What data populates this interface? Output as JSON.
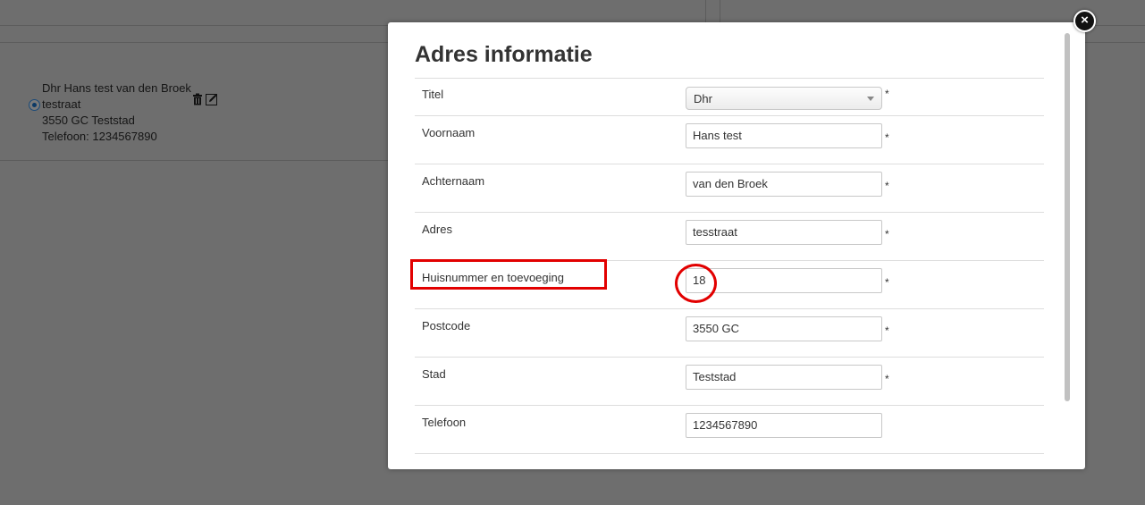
{
  "background": {
    "address": {
      "name_line": "Dhr Hans test van den Broek",
      "street_line": "testraat",
      "city_line": "3550 GC Teststad",
      "phone_line": "Telefoon: 1234567890"
    }
  },
  "modal": {
    "title": "Adres informatie",
    "required_mark": "*",
    "fields": [
      {
        "label": "Titel",
        "value": "Dhr",
        "type": "select",
        "required": true
      },
      {
        "label": "Voornaam",
        "value": "Hans test",
        "type": "text",
        "required": true
      },
      {
        "label": "Achternaam",
        "value": "van den Broek",
        "type": "text",
        "required": true
      },
      {
        "label": "Adres",
        "value": "tesstraat",
        "type": "text",
        "required": true
      },
      {
        "label": "Huisnummer en toevoeging",
        "value": "18",
        "type": "text",
        "required": true
      },
      {
        "label": "Postcode",
        "value": "3550 GC",
        "type": "text",
        "required": true
      },
      {
        "label": "Stad",
        "value": "Teststad",
        "type": "text",
        "required": true
      },
      {
        "label": "Telefoon",
        "value": "1234567890",
        "type": "text",
        "required": false
      }
    ],
    "close_label": "×"
  },
  "colors": {
    "overlay": "#6e6e6e",
    "annotation": "#e20000"
  }
}
